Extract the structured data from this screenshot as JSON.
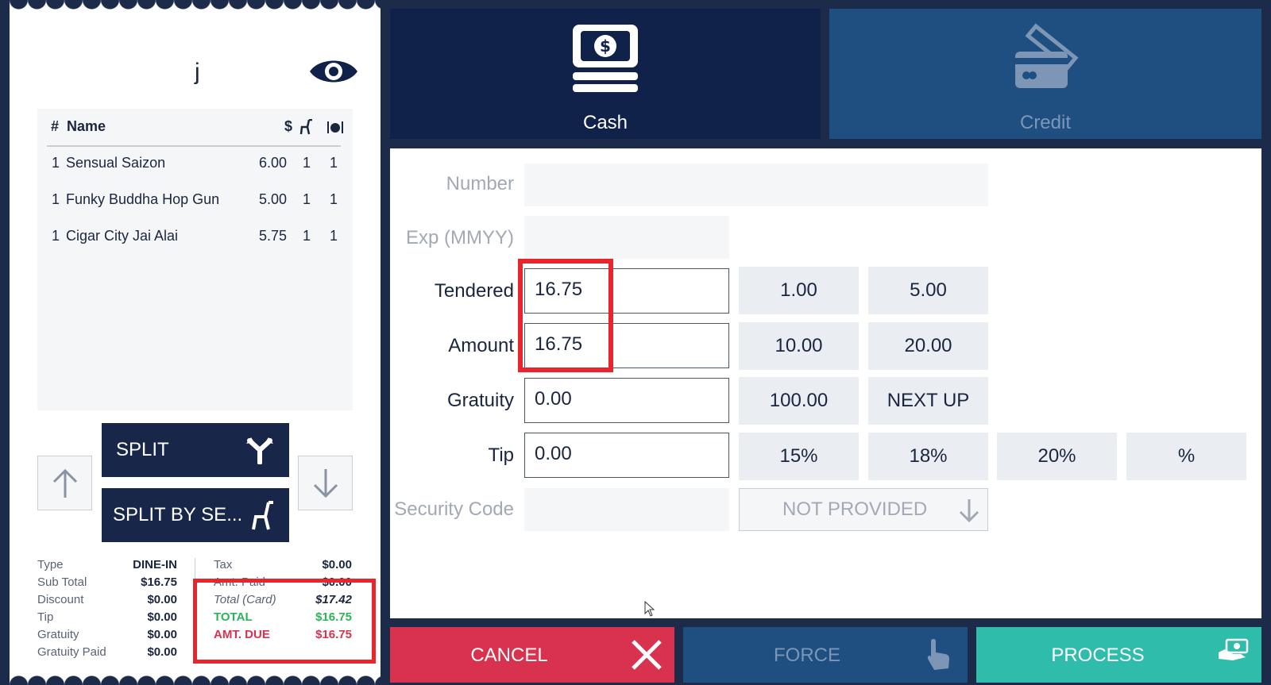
{
  "receipt": {
    "order_name": "j",
    "header": {
      "num": "#",
      "name": "Name",
      "price": "$"
    },
    "items": [
      {
        "qty": "1",
        "name": "Sensual Saizon",
        "price": "6.00",
        "seat": "1",
        "course": "1"
      },
      {
        "qty": "1",
        "name": "Funky Buddha Hop Gun",
        "price": "5.00",
        "seat": "1",
        "course": "1"
      },
      {
        "qty": "1",
        "name": "Cigar City Jai Alai",
        "price": "5.75",
        "seat": "1",
        "course": "1"
      }
    ],
    "split_label": "SPLIT",
    "split_by_seat_label": "SPLIT BY SE...",
    "summary_left": [
      {
        "k": "Type",
        "v": "DINE-IN"
      },
      {
        "k": "Sub Total",
        "v": "$16.75"
      },
      {
        "k": "Discount",
        "v": "$0.00"
      },
      {
        "k": "Tip",
        "v": "$0.00"
      },
      {
        "k": "Gratuity",
        "v": "$0.00"
      },
      {
        "k": "Gratuity Paid",
        "v": "$0.00"
      }
    ],
    "summary_right": [
      {
        "k": "Tax",
        "v": "$0.00"
      },
      {
        "k": "Amt. Paid",
        "v": "$0.00"
      },
      {
        "k": "Total (Card)",
        "v": "$17.42"
      },
      {
        "k": "TOTAL",
        "v": "$16.75"
      },
      {
        "k": "AMT. DUE",
        "v": "$16.75"
      }
    ]
  },
  "tabs": {
    "cash": "Cash",
    "credit": "Credit"
  },
  "form": {
    "number_label": "Number",
    "exp_label": "Exp (MMYY)",
    "tendered_label": "Tendered",
    "tendered_value": "16.75",
    "amount_label": "Amount",
    "amount_value": "16.75",
    "gratuity_label": "Gratuity",
    "gratuity_value": "0.00",
    "tip_label": "Tip",
    "tip_value": "0.00",
    "security_label": "Security Code",
    "security_select": "NOT PROVIDED",
    "quick_amounts": [
      "1.00",
      "5.00",
      "10.00",
      "20.00",
      "100.00",
      "NEXT UP"
    ],
    "tip_percents": [
      "15%",
      "18%",
      "20%",
      "%"
    ]
  },
  "buttons": {
    "cancel": "CANCEL",
    "force": "FORCE",
    "process": "PROCESS"
  },
  "colors": {
    "navy": "#11224a",
    "credit_blue": "#1e4f80",
    "cancel_red": "#d8324f",
    "process_teal": "#2fbcab",
    "total_green": "#2db35a",
    "highlight_red": "#e8242d"
  }
}
